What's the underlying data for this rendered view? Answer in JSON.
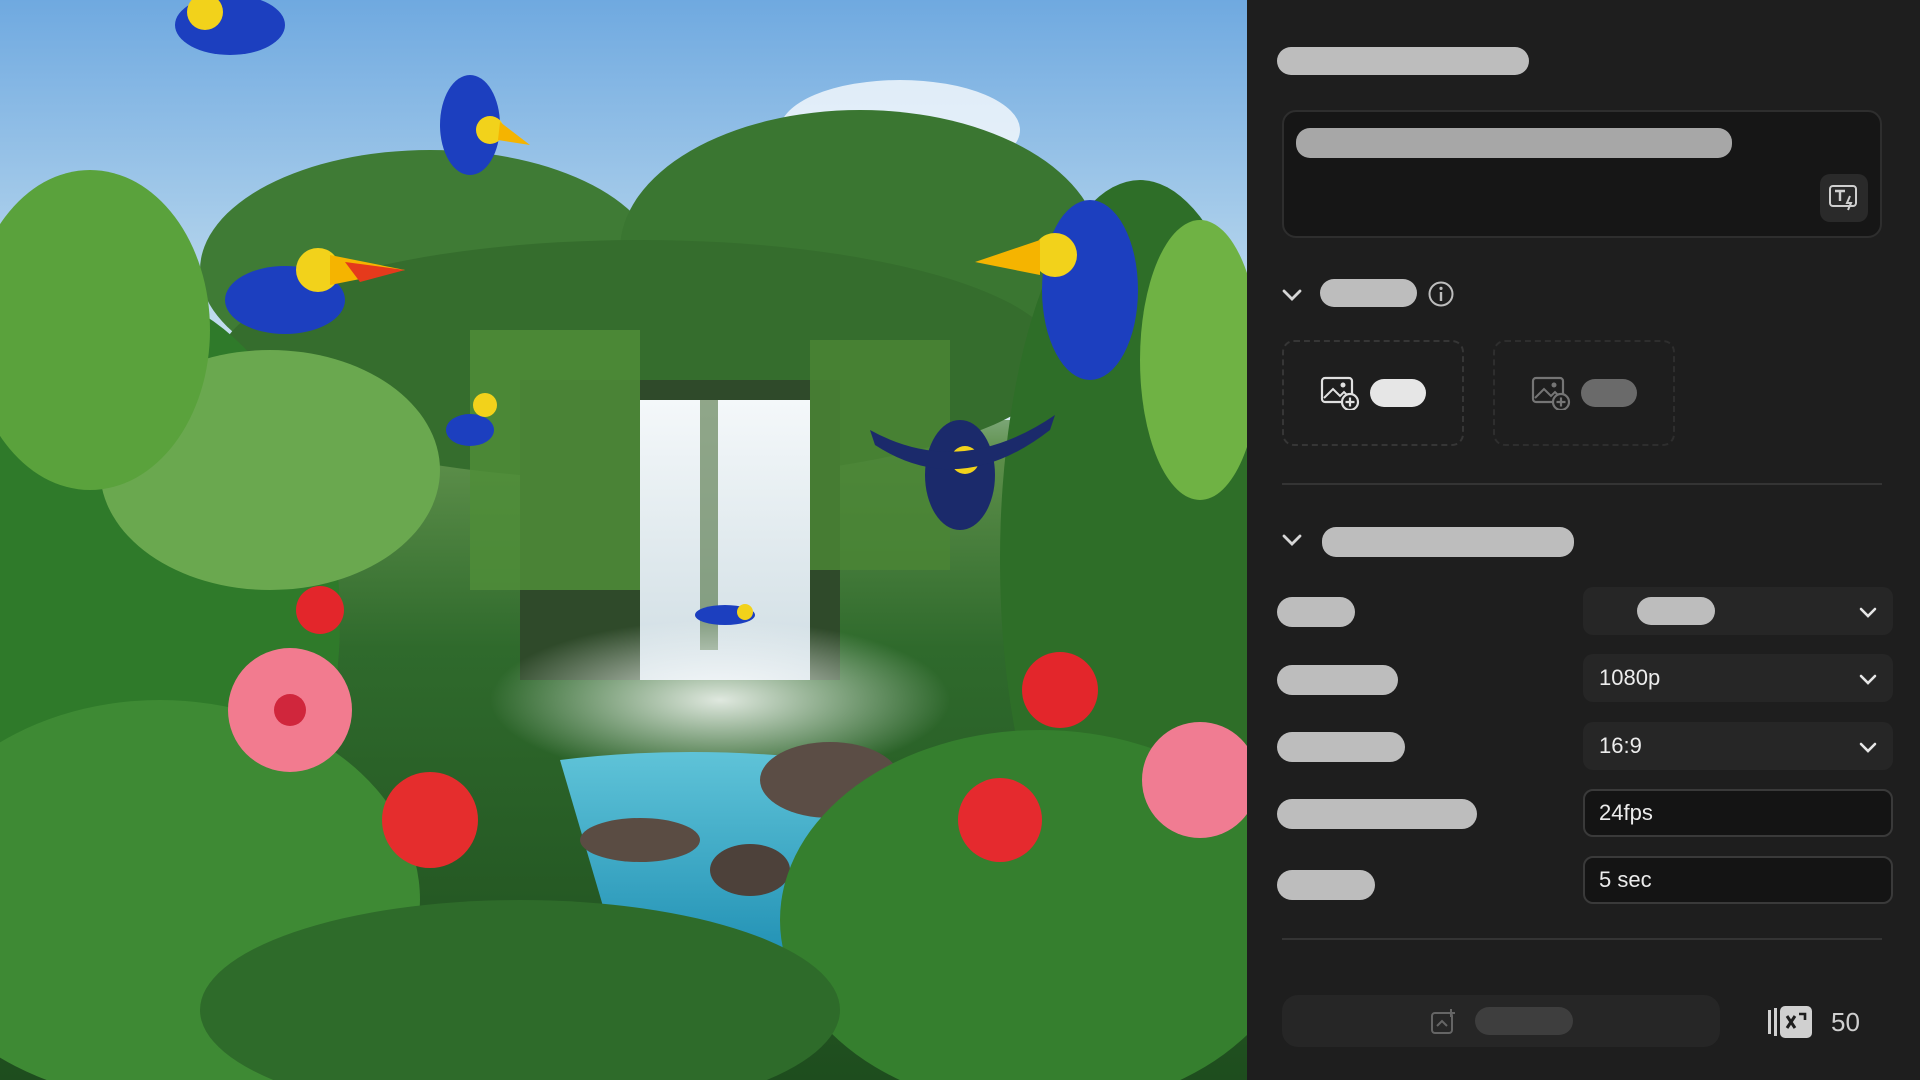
{
  "scene": {
    "icon": "jungle-waterfall-image"
  },
  "panel": {
    "prompt_icon": "text-style-icon",
    "section1": {
      "chevron_icon": "chevron-down-icon",
      "info_icon": "info-icon",
      "slots": [
        {
          "icon": "add-image-icon"
        },
        {
          "icon": "add-image-icon"
        }
      ]
    },
    "section2": {
      "chevron_icon": "chevron-down-icon",
      "rows": [
        {
          "kind": "select",
          "value": ""
        },
        {
          "kind": "select",
          "value": "1080p"
        },
        {
          "kind": "select",
          "value": "16:9"
        },
        {
          "kind": "input",
          "value": "24fps"
        },
        {
          "kind": "input",
          "value": "5 sec"
        }
      ]
    },
    "footer": {
      "generate_icon": "generate-icon",
      "credits_icon": "credits-icon",
      "credits": "50"
    }
  }
}
